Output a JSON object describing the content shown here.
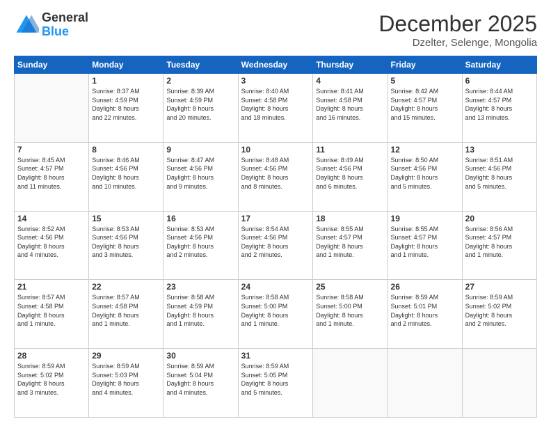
{
  "header": {
    "logo": {
      "line1": "General",
      "line2": "Blue"
    },
    "title": "December 2025",
    "subtitle": "Dzelter, Selenge, Mongolia"
  },
  "days_of_week": [
    "Sunday",
    "Monday",
    "Tuesday",
    "Wednesday",
    "Thursday",
    "Friday",
    "Saturday"
  ],
  "weeks": [
    [
      {
        "day": "",
        "info": ""
      },
      {
        "day": "1",
        "info": "Sunrise: 8:37 AM\nSunset: 4:59 PM\nDaylight: 8 hours\nand 22 minutes."
      },
      {
        "day": "2",
        "info": "Sunrise: 8:39 AM\nSunset: 4:59 PM\nDaylight: 8 hours\nand 20 minutes."
      },
      {
        "day": "3",
        "info": "Sunrise: 8:40 AM\nSunset: 4:58 PM\nDaylight: 8 hours\nand 18 minutes."
      },
      {
        "day": "4",
        "info": "Sunrise: 8:41 AM\nSunset: 4:58 PM\nDaylight: 8 hours\nand 16 minutes."
      },
      {
        "day": "5",
        "info": "Sunrise: 8:42 AM\nSunset: 4:57 PM\nDaylight: 8 hours\nand 15 minutes."
      },
      {
        "day": "6",
        "info": "Sunrise: 8:44 AM\nSunset: 4:57 PM\nDaylight: 8 hours\nand 13 minutes."
      }
    ],
    [
      {
        "day": "7",
        "info": "Sunrise: 8:45 AM\nSunset: 4:57 PM\nDaylight: 8 hours\nand 11 minutes."
      },
      {
        "day": "8",
        "info": "Sunrise: 8:46 AM\nSunset: 4:56 PM\nDaylight: 8 hours\nand 10 minutes."
      },
      {
        "day": "9",
        "info": "Sunrise: 8:47 AM\nSunset: 4:56 PM\nDaylight: 8 hours\nand 9 minutes."
      },
      {
        "day": "10",
        "info": "Sunrise: 8:48 AM\nSunset: 4:56 PM\nDaylight: 8 hours\nand 8 minutes."
      },
      {
        "day": "11",
        "info": "Sunrise: 8:49 AM\nSunset: 4:56 PM\nDaylight: 8 hours\nand 6 minutes."
      },
      {
        "day": "12",
        "info": "Sunrise: 8:50 AM\nSunset: 4:56 PM\nDaylight: 8 hours\nand 5 minutes."
      },
      {
        "day": "13",
        "info": "Sunrise: 8:51 AM\nSunset: 4:56 PM\nDaylight: 8 hours\nand 5 minutes."
      }
    ],
    [
      {
        "day": "14",
        "info": "Sunrise: 8:52 AM\nSunset: 4:56 PM\nDaylight: 8 hours\nand 4 minutes."
      },
      {
        "day": "15",
        "info": "Sunrise: 8:53 AM\nSunset: 4:56 PM\nDaylight: 8 hours\nand 3 minutes."
      },
      {
        "day": "16",
        "info": "Sunrise: 8:53 AM\nSunset: 4:56 PM\nDaylight: 8 hours\nand 2 minutes."
      },
      {
        "day": "17",
        "info": "Sunrise: 8:54 AM\nSunset: 4:56 PM\nDaylight: 8 hours\nand 2 minutes."
      },
      {
        "day": "18",
        "info": "Sunrise: 8:55 AM\nSunset: 4:57 PM\nDaylight: 8 hours\nand 1 minute."
      },
      {
        "day": "19",
        "info": "Sunrise: 8:55 AM\nSunset: 4:57 PM\nDaylight: 8 hours\nand 1 minute."
      },
      {
        "day": "20",
        "info": "Sunrise: 8:56 AM\nSunset: 4:57 PM\nDaylight: 8 hours\nand 1 minute."
      }
    ],
    [
      {
        "day": "21",
        "info": "Sunrise: 8:57 AM\nSunset: 4:58 PM\nDaylight: 8 hours\nand 1 minute."
      },
      {
        "day": "22",
        "info": "Sunrise: 8:57 AM\nSunset: 4:58 PM\nDaylight: 8 hours\nand 1 minute."
      },
      {
        "day": "23",
        "info": "Sunrise: 8:58 AM\nSunset: 4:59 PM\nDaylight: 8 hours\nand 1 minute."
      },
      {
        "day": "24",
        "info": "Sunrise: 8:58 AM\nSunset: 5:00 PM\nDaylight: 8 hours\nand 1 minute."
      },
      {
        "day": "25",
        "info": "Sunrise: 8:58 AM\nSunset: 5:00 PM\nDaylight: 8 hours\nand 1 minute."
      },
      {
        "day": "26",
        "info": "Sunrise: 8:59 AM\nSunset: 5:01 PM\nDaylight: 8 hours\nand 2 minutes."
      },
      {
        "day": "27",
        "info": "Sunrise: 8:59 AM\nSunset: 5:02 PM\nDaylight: 8 hours\nand 2 minutes."
      }
    ],
    [
      {
        "day": "28",
        "info": "Sunrise: 8:59 AM\nSunset: 5:02 PM\nDaylight: 8 hours\nand 3 minutes."
      },
      {
        "day": "29",
        "info": "Sunrise: 8:59 AM\nSunset: 5:03 PM\nDaylight: 8 hours\nand 4 minutes."
      },
      {
        "day": "30",
        "info": "Sunrise: 8:59 AM\nSunset: 5:04 PM\nDaylight: 8 hours\nand 4 minutes."
      },
      {
        "day": "31",
        "info": "Sunrise: 8:59 AM\nSunset: 5:05 PM\nDaylight: 8 hours\nand 5 minutes."
      },
      {
        "day": "",
        "info": ""
      },
      {
        "day": "",
        "info": ""
      },
      {
        "day": "",
        "info": ""
      }
    ]
  ]
}
